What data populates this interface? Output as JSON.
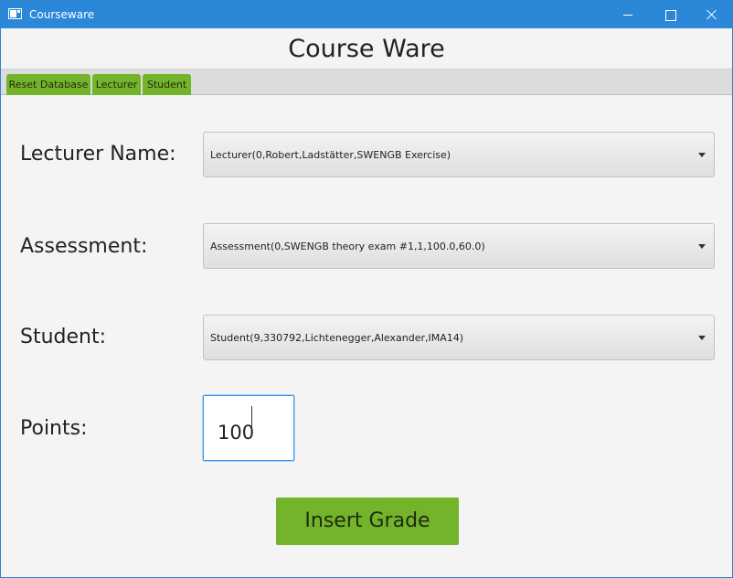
{
  "window": {
    "title": "Courseware",
    "icon": "app-window-icon",
    "controls": [
      "minimize-icon",
      "maximize-icon",
      "close-icon"
    ]
  },
  "header": {
    "title": "Course Ware"
  },
  "tabs": [
    {
      "label": "Reset Database"
    },
    {
      "label": "Lecturer"
    },
    {
      "label": "Student"
    }
  ],
  "form": {
    "lecturer": {
      "label": "Lecturer Name:",
      "selected": "Lecturer(0,Robert,Ladstätter,SWENGB Exercise)"
    },
    "assessment": {
      "label": "Assessment:",
      "selected": "Assessment(0,SWENGB theory exam #1,1,100.0,60.0)"
    },
    "student": {
      "label": "Student:",
      "selected": "Student(9,330792,Lichtenegger,Alexander,IMA14)"
    },
    "points": {
      "label": "Points:",
      "value": "100"
    },
    "submit_label": "Insert Grade"
  },
  "colors": {
    "titlebar": "#2b88d8",
    "accent_green": "#74b42a",
    "focus_blue": "#3d9ae8",
    "background": "#f4f4f4"
  }
}
